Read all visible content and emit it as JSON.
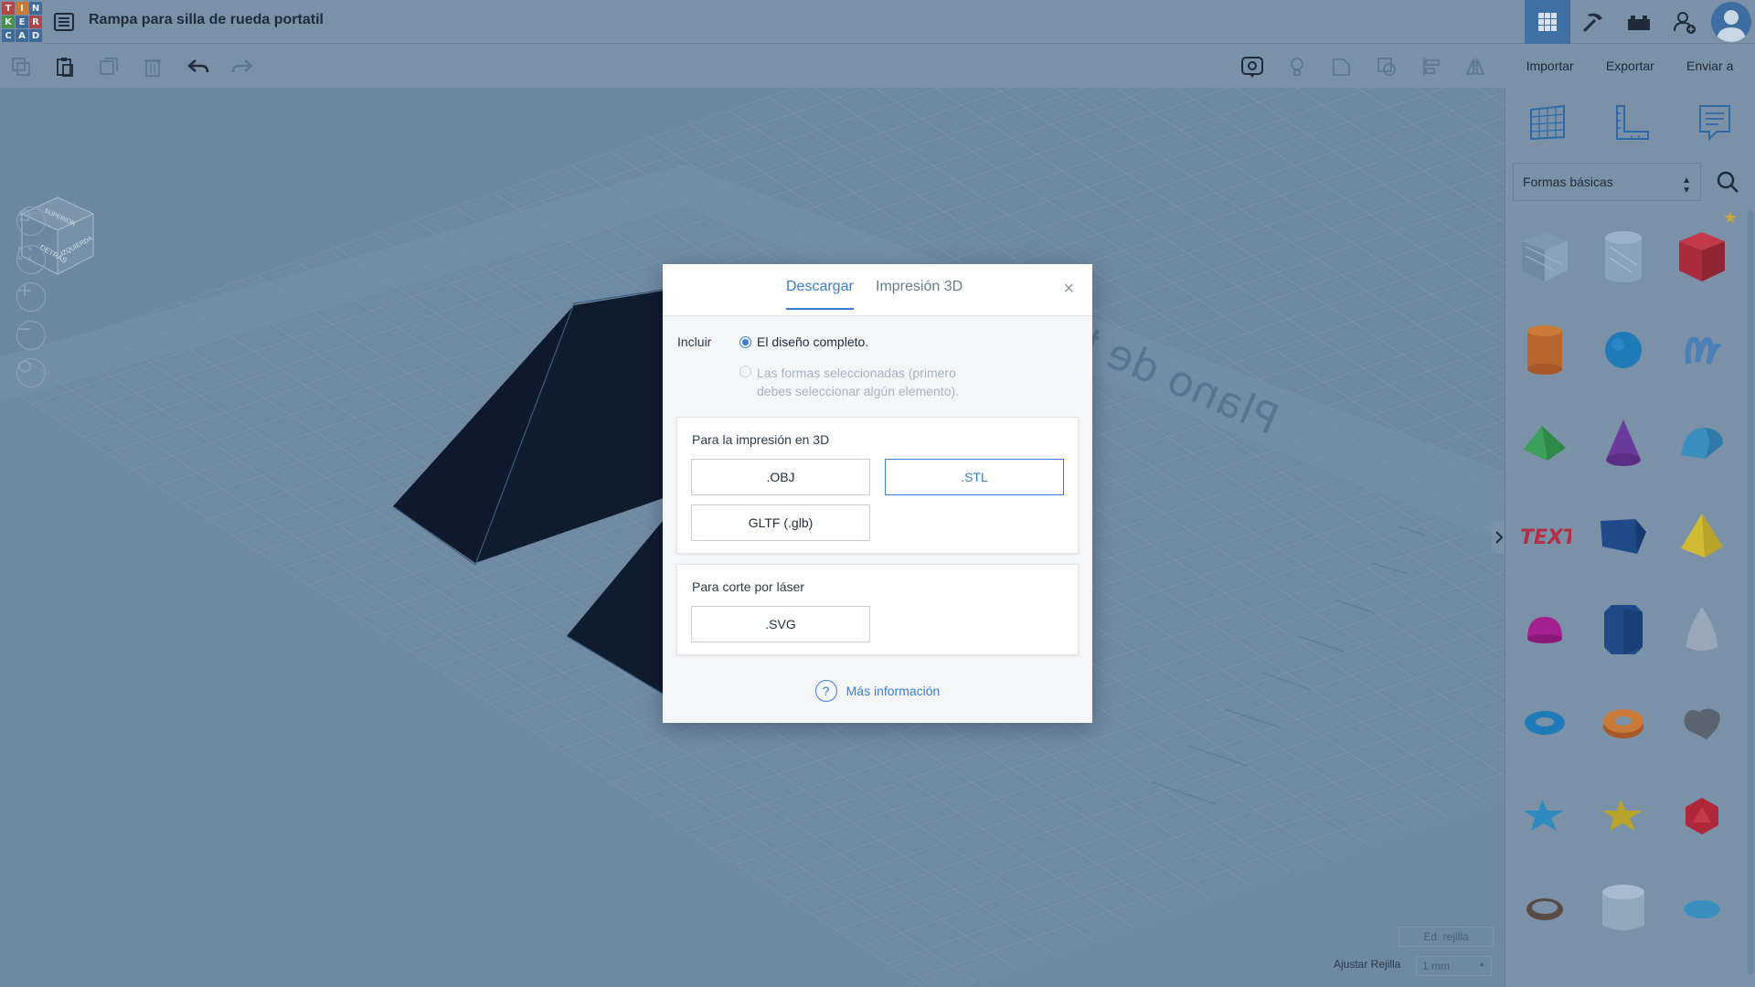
{
  "app": {
    "logo_letters": [
      "T",
      "I",
      "N",
      "K",
      "E",
      "R",
      "C",
      "A",
      "D"
    ],
    "design_title": "Rampa para silla de rueda portatil"
  },
  "toolbar": {
    "import_label": "Importar",
    "export_label": "Exportar",
    "send_label": "Enviar a"
  },
  "viewport": {
    "workplane_text": "Plano de tra",
    "viewcube_faces": [
      "DETRÁS",
      "IZQUIERDA",
      "SUPERIOR"
    ]
  },
  "grid_controls": {
    "edit_grid_label": "Ed. rejilla",
    "snap_label": "Ajustar Rejilla",
    "snap_value": "1 mm"
  },
  "panel": {
    "shapes_category": "Formas básicas",
    "shapes": [
      "box-striped",
      "cylinder-striped",
      "box",
      "cylinder",
      "sphere",
      "scribble",
      "roof",
      "cone",
      "round-roof",
      "text",
      "wedge",
      "pyramid",
      "half-sphere",
      "polygon",
      "paraboloid",
      "torus",
      "tube",
      "heart",
      "star",
      "star-yellow",
      "icosahedron",
      "ring",
      "cylinder-hole",
      "ellipsoid"
    ]
  },
  "dialog": {
    "tabs": {
      "download": "Descargar",
      "print3d": "Impresión 3D"
    },
    "close_symbol": "×",
    "include_label": "Incluir",
    "option_full": "El diseño completo.",
    "option_selected_line1": "Las formas seleccionadas (primero",
    "option_selected_line2": "debes seleccionar algún elemento).",
    "section_3d_title": "Para la impresión en 3D",
    "btn_obj": ".OBJ",
    "btn_stl": ".STL",
    "btn_gltf": "GLTF (.glb)",
    "section_laser_title": "Para corte por láser",
    "btn_svg": ".SVG",
    "help_symbol": "?",
    "more_info": "Más información"
  }
}
